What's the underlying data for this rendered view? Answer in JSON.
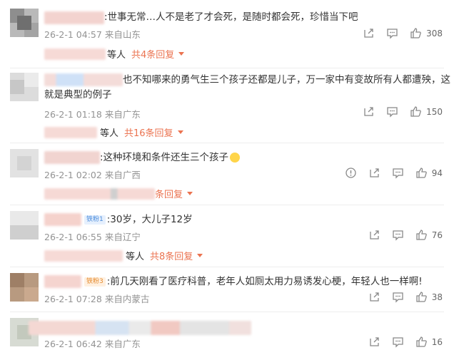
{
  "comments": [
    {
      "text": ":世事无常…人不是老了才会死，是随时都会死，珍惜当下吧",
      "date": "26-2-1 04:57",
      "location": "来自山东",
      "likes": "308",
      "reply": {
        "suffix": "等人",
        "link": "共4条回复"
      }
    },
    {
      "text": "也不知哪来的勇气生三个孩子还都是儿子，万一家中有变故所有人都遭殃，这",
      "text2": "就是典型的例子",
      "date": "26-2-1 01:18",
      "location": "来自广东",
      "likes": "150",
      "reply": {
        "suffix": "等人",
        "link": "共16条回复"
      }
    },
    {
      "text": ":这种环境和条件还生三个孩子",
      "date": "26-2-1 02:02",
      "location": "来自广西",
      "likes": "94",
      "reply": {
        "suffix": "",
        "link": "条回复"
      }
    },
    {
      "badge": "铁粉1",
      "text": ":30岁，大儿子12岁",
      "date": "26-2-1 06:55",
      "location": "来自辽宁",
      "likes": "76",
      "reply": {
        "suffix": "等人",
        "link": "共8条回复"
      }
    },
    {
      "badge": "铁粉3",
      "text": ":前几天刚看了医疗科普，老年人如厕太用力易诱发心梗，年轻人也一样啊!",
      "date": "26-2-1 07:28",
      "location": "来自内蒙古",
      "likes": "38"
    },
    {
      "date": "26-2-1 06:42",
      "location": "来自广东",
      "likes": "16"
    }
  ],
  "icons": {
    "share": "share-icon",
    "comment": "comment-icon",
    "like": "thumbs-up-icon",
    "report": "report-icon"
  },
  "colors": {
    "accent": "#eb7350",
    "meta": "#939393"
  }
}
